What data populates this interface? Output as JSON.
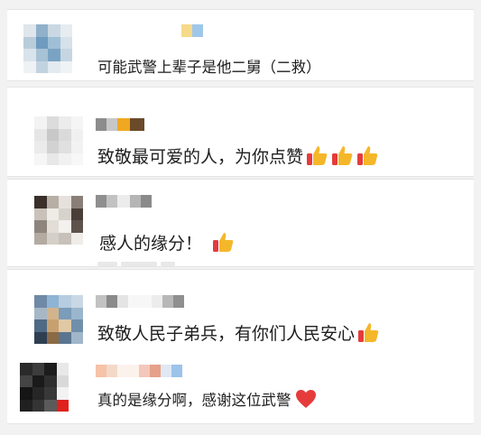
{
  "comments": [
    {
      "text": "可能武警上辈子是他二舅（二救）"
    },
    {
      "text": "致敬最可爱的人，为你点赞"
    },
    {
      "text": "感人的缘分！"
    },
    {
      "text": "致敬人民子弟兵，有你们人民安心"
    },
    {
      "text": "真的是缘分啊，感谢这位武警"
    }
  ],
  "icons": {
    "thumb": "thumbs-up-icon",
    "heart": "red-heart-icon"
  },
  "colors": {
    "thumb": "#f5b72a",
    "heart": "#e53b3b",
    "text": "#1e1e1e"
  }
}
